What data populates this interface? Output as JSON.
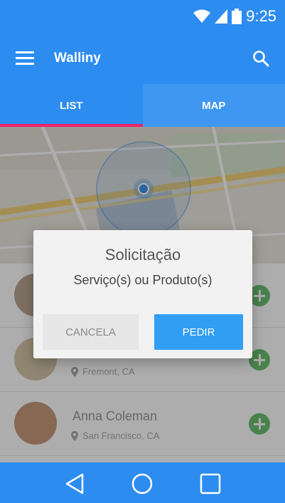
{
  "status_bar": {
    "time": "9:25",
    "icons": [
      "wifi-icon",
      "signal-icon",
      "battery-icon"
    ]
  },
  "app_bar": {
    "title": "Walliny",
    "menu_icon": "menu-icon",
    "search_icon": "search-icon"
  },
  "tabs": [
    {
      "label": "LIST",
      "active": true
    },
    {
      "label": "MAP",
      "active": false
    }
  ],
  "list": {
    "items": [
      {
        "name": "",
        "location": ""
      },
      {
        "name": "",
        "location": "Fremont, CA"
      },
      {
        "name": "Anna Coleman",
        "location": "San Francisco, CA"
      }
    ]
  },
  "dialog": {
    "title": "Solicitação",
    "message": "Serviço(s) ou Produto(s)",
    "cancel_label": "CANCELA",
    "confirm_label": "PEDIR"
  },
  "nav_bar": {
    "icons": [
      "back-icon",
      "home-icon",
      "recents-icon"
    ]
  },
  "colors": {
    "primary": "#2d8cf0",
    "tab_indicator": "#f0226b",
    "add_button": "#6cc070",
    "dialog_confirm": "#2f9ef4"
  }
}
